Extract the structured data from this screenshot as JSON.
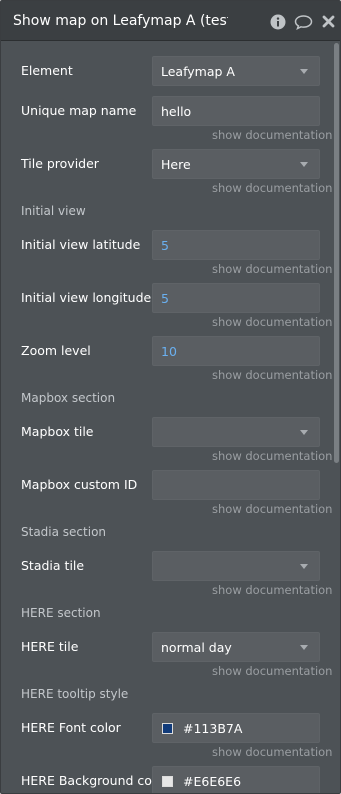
{
  "header": {
    "title": "Show map on Leafymap A (testing)"
  },
  "icons": {
    "info": "info-icon",
    "comment": "comment-icon",
    "close": "close-icon"
  },
  "fields": {
    "element": {
      "label": "Element",
      "value": "Leafymap A"
    },
    "unique_name": {
      "label": "Unique map name",
      "value": "hello"
    },
    "tile_provider": {
      "label": "Tile provider",
      "value": "Here"
    },
    "initial_view_section": "Initial view",
    "latitude": {
      "label": "Initial view latitude",
      "value": "5"
    },
    "longitude": {
      "label": "Initial view longitude",
      "value": "5"
    },
    "zoom": {
      "label": "Zoom level",
      "value": "10"
    },
    "mapbox_section": "Mapbox section",
    "mapbox_tile": {
      "label": "Mapbox tile",
      "value": ""
    },
    "mapbox_custom_id": {
      "label": "Mapbox custom ID",
      "value": ""
    },
    "stadia_section": "Stadia section",
    "stadia_tile": {
      "label": "Stadia tile",
      "value": ""
    },
    "here_section": "HERE section",
    "here_tile": {
      "label": "HERE tile",
      "value": "normal day"
    },
    "here_tooltip_section": "HERE tooltip style",
    "here_font_color": {
      "label": "HERE Font color",
      "value": "#113B7A",
      "swatch": "#113B7A"
    },
    "here_bg_color": {
      "label": "HERE Background col",
      "value": "#E6E6E6",
      "swatch": "#E6E6E6"
    }
  },
  "doc_link": "show documentation"
}
